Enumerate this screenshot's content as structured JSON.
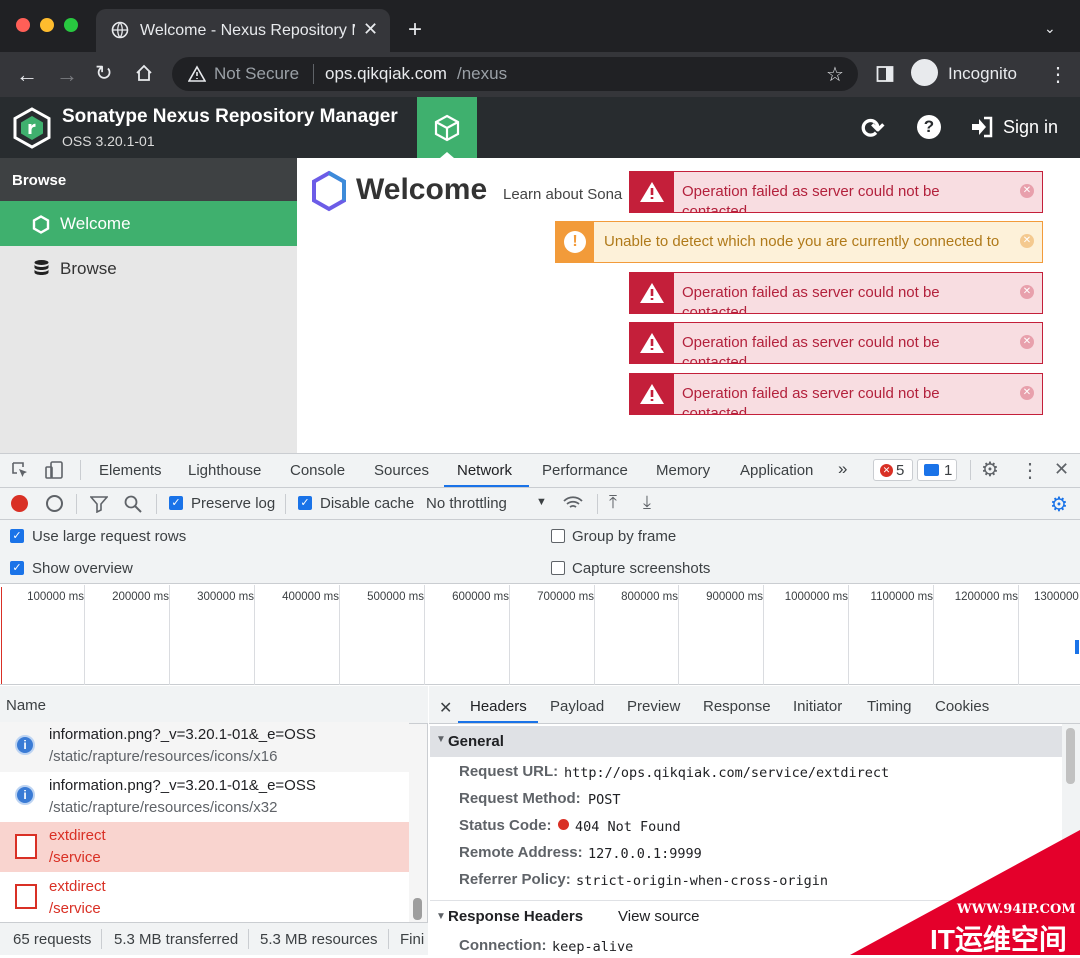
{
  "browser": {
    "tab_title": "Welcome - Nexus Repository M",
    "security_label": "Not Secure",
    "url_host": "ops.qikqiak.com",
    "url_path": "/nexus",
    "profile_label": "Incognito"
  },
  "app": {
    "title": "Sonatype Nexus Repository Manager",
    "version": "OSS 3.20.1-01",
    "sign_in": "Sign in",
    "brand_color": "#3fb06e"
  },
  "sidebar": {
    "heading": "Browse",
    "items": [
      {
        "label": "Welcome",
        "icon": "hexagon-icon",
        "active": true
      },
      {
        "label": "Browse",
        "icon": "database-icon",
        "active": false
      }
    ]
  },
  "main": {
    "heading": "Welcome",
    "subtitle": "Learn about Sona"
  },
  "toasts": [
    {
      "type": "error",
      "message": "Operation failed as server could not be contacted"
    },
    {
      "type": "warning",
      "message": "Unable to detect which node you are currently connected to"
    },
    {
      "type": "error",
      "message": "Operation failed as server could not be contacted"
    },
    {
      "type": "error",
      "message": "Operation failed as server could not be contacted"
    },
    {
      "type": "error",
      "message": "Operation failed as server could not be contacted"
    }
  ],
  "devtools": {
    "tabs": [
      "Elements",
      "Lighthouse",
      "Console",
      "Sources",
      "Network",
      "Performance",
      "Memory",
      "Application"
    ],
    "active_tab": "Network",
    "error_count": "5",
    "message_count": "1",
    "toolbar": {
      "preserve_log": "Preserve log",
      "disable_cache": "Disable cache",
      "throttling": "No throttling"
    },
    "options": {
      "large_rows": "Use large request rows",
      "show_overview": "Show overview",
      "group_by_frame": "Group by frame",
      "capture_screenshots": "Capture screenshots"
    },
    "timeline_ticks": [
      "100000 ms",
      "200000 ms",
      "300000 ms",
      "400000 ms",
      "500000 ms",
      "600000 ms",
      "700000 ms",
      "800000 ms",
      "900000 ms",
      "1000000 ms",
      "1100000 ms",
      "1200000 ms",
      "1300000"
    ],
    "name_header": "Name",
    "requests": [
      {
        "name": "information.png?_v=3.20.1-01&_e=OSS",
        "path": "/static/rapture/resources/icons/x16",
        "failed": false
      },
      {
        "name": "information.png?_v=3.20.1-01&_e=OSS",
        "path": "/static/rapture/resources/icons/x32",
        "failed": false
      },
      {
        "name": "extdirect",
        "path": "/service",
        "failed": true
      },
      {
        "name": "extdirect",
        "path": "/service",
        "failed": true
      }
    ],
    "status_bar": {
      "requests": "65 requests",
      "transferred": "5.3 MB transferred",
      "resources": "5.3 MB resources",
      "finish": "Fini"
    },
    "detail_tabs": [
      "Headers",
      "Payload",
      "Preview",
      "Response",
      "Initiator",
      "Timing",
      "Cookies"
    ],
    "detail_active": "Headers",
    "general_label": "General",
    "general": [
      {
        "key": "Request URL:",
        "value": "http://ops.qikqiak.com/service/extdirect"
      },
      {
        "key": "Request Method:",
        "value": "POST"
      },
      {
        "key": "Status Code:",
        "value": "404 Not Found"
      },
      {
        "key": "Remote Address:",
        "value": "127.0.0.1:9999"
      },
      {
        "key": "Referrer Policy:",
        "value": "strict-origin-when-cross-origin"
      }
    ],
    "response_headers_label": "Response Headers",
    "view_source": "View source",
    "response_headers": [
      {
        "key": "Connection:",
        "value": "keep-alive"
      }
    ]
  },
  "watermark": {
    "site": "WWW.94IP.COM",
    "brand": "IT运维空间"
  }
}
